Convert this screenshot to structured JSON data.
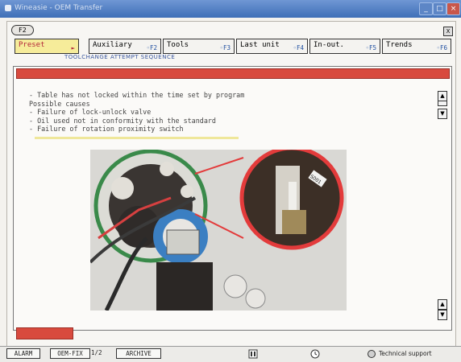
{
  "window": {
    "title": "Wineasie - OEM Transfer"
  },
  "header": {
    "f2_key": "F2",
    "close": "X"
  },
  "tabs": [
    {
      "label": "Preset",
      "key": "►"
    },
    {
      "label": "Auxiliary",
      "key": "◦F2"
    },
    {
      "label": "Tools",
      "key": "◦F3"
    },
    {
      "label": "Last unit",
      "key": "◦F4"
    },
    {
      "label": "In-out.",
      "key": "◦F5"
    },
    {
      "label": "Trends",
      "key": "◦F6"
    }
  ],
  "tab_subtitle": "TOOLCHANGE ATTEMPT SEQUENCE",
  "content": {
    "lines": [
      "- Table has not locked within the time set by program",
      "Possible causes",
      "- Failure of lock-unlock valve",
      "- Oil used not in conformity with the standard",
      "- Failure of rotation proximity switch"
    ],
    "photo_label": "S001"
  },
  "scroll": {
    "up": "▲",
    "down": "▼"
  },
  "statusbar": {
    "alarm": "ALARM",
    "oem": "OEM-FIX",
    "page": "1/2",
    "archive": "ARCHIVE",
    "support": "Technical support"
  },
  "colors": {
    "accent_red": "#d84a3e",
    "tab_active": "#f6ec9a",
    "title_blue": "#3f6fb7"
  }
}
